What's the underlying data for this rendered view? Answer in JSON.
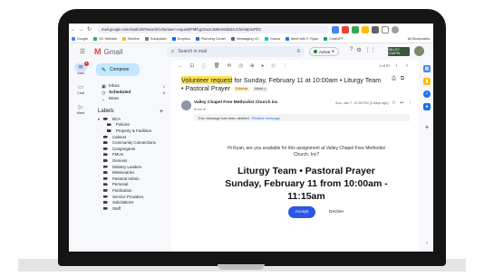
{
  "browser": {
    "url": "mail.google.com/mail/u/0/#search/volunteer+request/FMfcgzGwzcSBkHMnBZzvCbmWpnxPDz",
    "nav_back": "←",
    "nav_forward": "→",
    "nav_reload": "↻",
    "bookmarks": [
      {
        "label": "Google",
        "color": "#4285f4"
      },
      {
        "label": "SC Website",
        "color": "#34a853"
      },
      {
        "label": "Beeline",
        "color": "#fbbc04"
      },
      {
        "label": "Subsplash",
        "color": "#777777"
      },
      {
        "label": "Dropbox",
        "color": "#0061ff"
      },
      {
        "label": "Planning Center",
        "color": "#2b6cb0"
      },
      {
        "label": "Messaging VC",
        "color": "#5f6368"
      },
      {
        "label": "Canva",
        "color": "#00c4cc"
      },
      {
        "label": "Meet with F. Ryan",
        "color": "#1a73e8"
      },
      {
        "label": "ChatGPT",
        "color": "#10a37f"
      }
    ],
    "all_bookmarks": "All Bookmarks"
  },
  "gmail": {
    "brand": "Gmail",
    "search_placeholder": "Search in mail",
    "status": "Active",
    "brand_badge": "VALLEY CHAPEL",
    "rail": [
      {
        "label": "Mail",
        "badge": "6"
      },
      {
        "label": "Chat"
      },
      {
        "label": "Meet"
      }
    ],
    "compose": "Compose",
    "folders": [
      {
        "label": "Inbox",
        "count": "1"
      },
      {
        "label": "Scheduled",
        "count": "6"
      },
      {
        "label": "More",
        "count": ""
      }
    ],
    "labels_header": "Labels",
    "labels": [
      {
        "label": "BCA",
        "level": "top"
      },
      {
        "label": "Policies",
        "level": "sub"
      },
      {
        "label": "Property & Facilities",
        "level": "sub"
      },
      {
        "label": "Cabinet",
        "level": "top"
      },
      {
        "label": "Community Connections",
        "level": "top"
      },
      {
        "label": "Congregants",
        "level": "top"
      },
      {
        "label": "FMLN",
        "level": "top"
      },
      {
        "label": "Genesis",
        "level": "top"
      },
      {
        "label": "Ministry Leaders",
        "level": "top"
      },
      {
        "label": "Missionaries",
        "level": "top"
      },
      {
        "label": "Pastoral Admin",
        "level": "top"
      },
      {
        "label": "Personal",
        "level": "top"
      },
      {
        "label": "Publication",
        "level": "top"
      },
      {
        "label": "Service Providers",
        "level": "top"
      },
      {
        "label": "Solicitations",
        "level": "top"
      },
      {
        "label": "Staff",
        "level": "top"
      }
    ]
  },
  "email": {
    "pager": "1 of 37",
    "subject_highlight": "Volunteer request",
    "subject_rest": " for Sunday, February 11 at 10:00am • Liturgy Team • Pastoral Prayer",
    "chip_external": "External",
    "chip_inbox": "Inbox ×",
    "sender": "Valley Chapel Free Methodist Church Inc",
    "to": "to me ▾",
    "date": "Sun, Jan 7, 12:38 PM (3 days ago)",
    "deleted_notice": "This message has been deleted.",
    "restore": "Restore message",
    "message": "Hi Ryan, are you available for this assignment at Valley Chapel Free Methodist Church, Inc?",
    "title_line1": "Liturgy Team • Pastoral Prayer",
    "title_line2": "Sunday, February 11 from 10:00am -",
    "title_line3": "11:15am",
    "accept": "Accept",
    "decline": "Decline"
  }
}
